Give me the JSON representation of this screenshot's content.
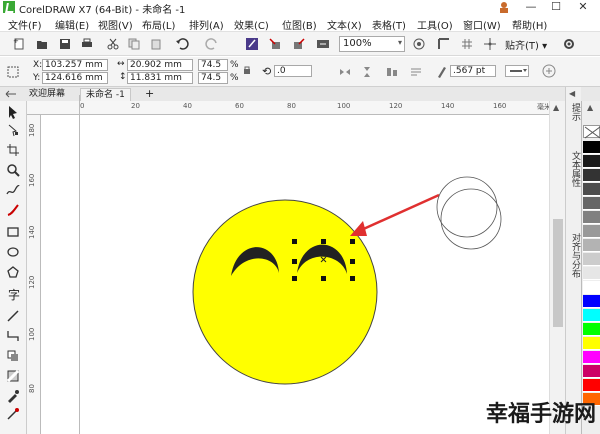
{
  "app": {
    "title": "CorelDRAW X7 (64-Bit) - 未命名 -1"
  },
  "window_buttons": [
    "—",
    "☐",
    "✕"
  ],
  "menu": {
    "items": [
      "文件(F)",
      "编辑(E)",
      "视图(V)",
      "布局(L)",
      "排列(A)",
      "效果(C)",
      "位图(B)",
      "文本(X)",
      "表格(T)",
      "工具(O)",
      "窗口(W)",
      "帮助(H)"
    ]
  },
  "toolbar": {
    "zoom": "100%",
    "snap_label": "贴齐(T) ▾"
  },
  "property_bar": {
    "x_label": "X:",
    "x_value": "103.257 mm",
    "y_label": "Y:",
    "y_value": "124.616 mm",
    "w_value": "20.902 mm",
    "h_value": "11.831 mm",
    "scale_w": "74.5",
    "scale_h": "74.5",
    "pct1": "%",
    "pct2": "%",
    "rotation": ".0",
    "outline_width": ".567 pt"
  },
  "doc_tabs": {
    "welcome": "欢迎屏幕",
    "doc": "未命名 -1",
    "add": "+"
  },
  "ruler": {
    "h_ticks": [
      "0",
      "20",
      "40",
      "60",
      "80",
      "100",
      "120",
      "140",
      "160",
      "180"
    ],
    "h_unit": "毫米",
    "v_ticks": [
      "180",
      "160",
      "140",
      "120",
      "100",
      "80"
    ]
  },
  "dockers": {
    "hint": "提示",
    "text_props": "文本属性",
    "align": "对齐与分布"
  },
  "palette": {
    "colors": [
      "#ffffff",
      "#000000",
      "#1a1a1a",
      "#333333",
      "#4d4d4d",
      "#666666",
      "#808080",
      "#999999",
      "#b3b3b3",
      "#cccccc",
      "#e6e6e6",
      "#ffffff",
      "#0000ff",
      "#00ffff",
      "#00ff00",
      "#ffff00",
      "#ff00ff",
      "#cc0066",
      "#ff0000",
      "#ff6600"
    ]
  },
  "watermark": "幸福手游网"
}
